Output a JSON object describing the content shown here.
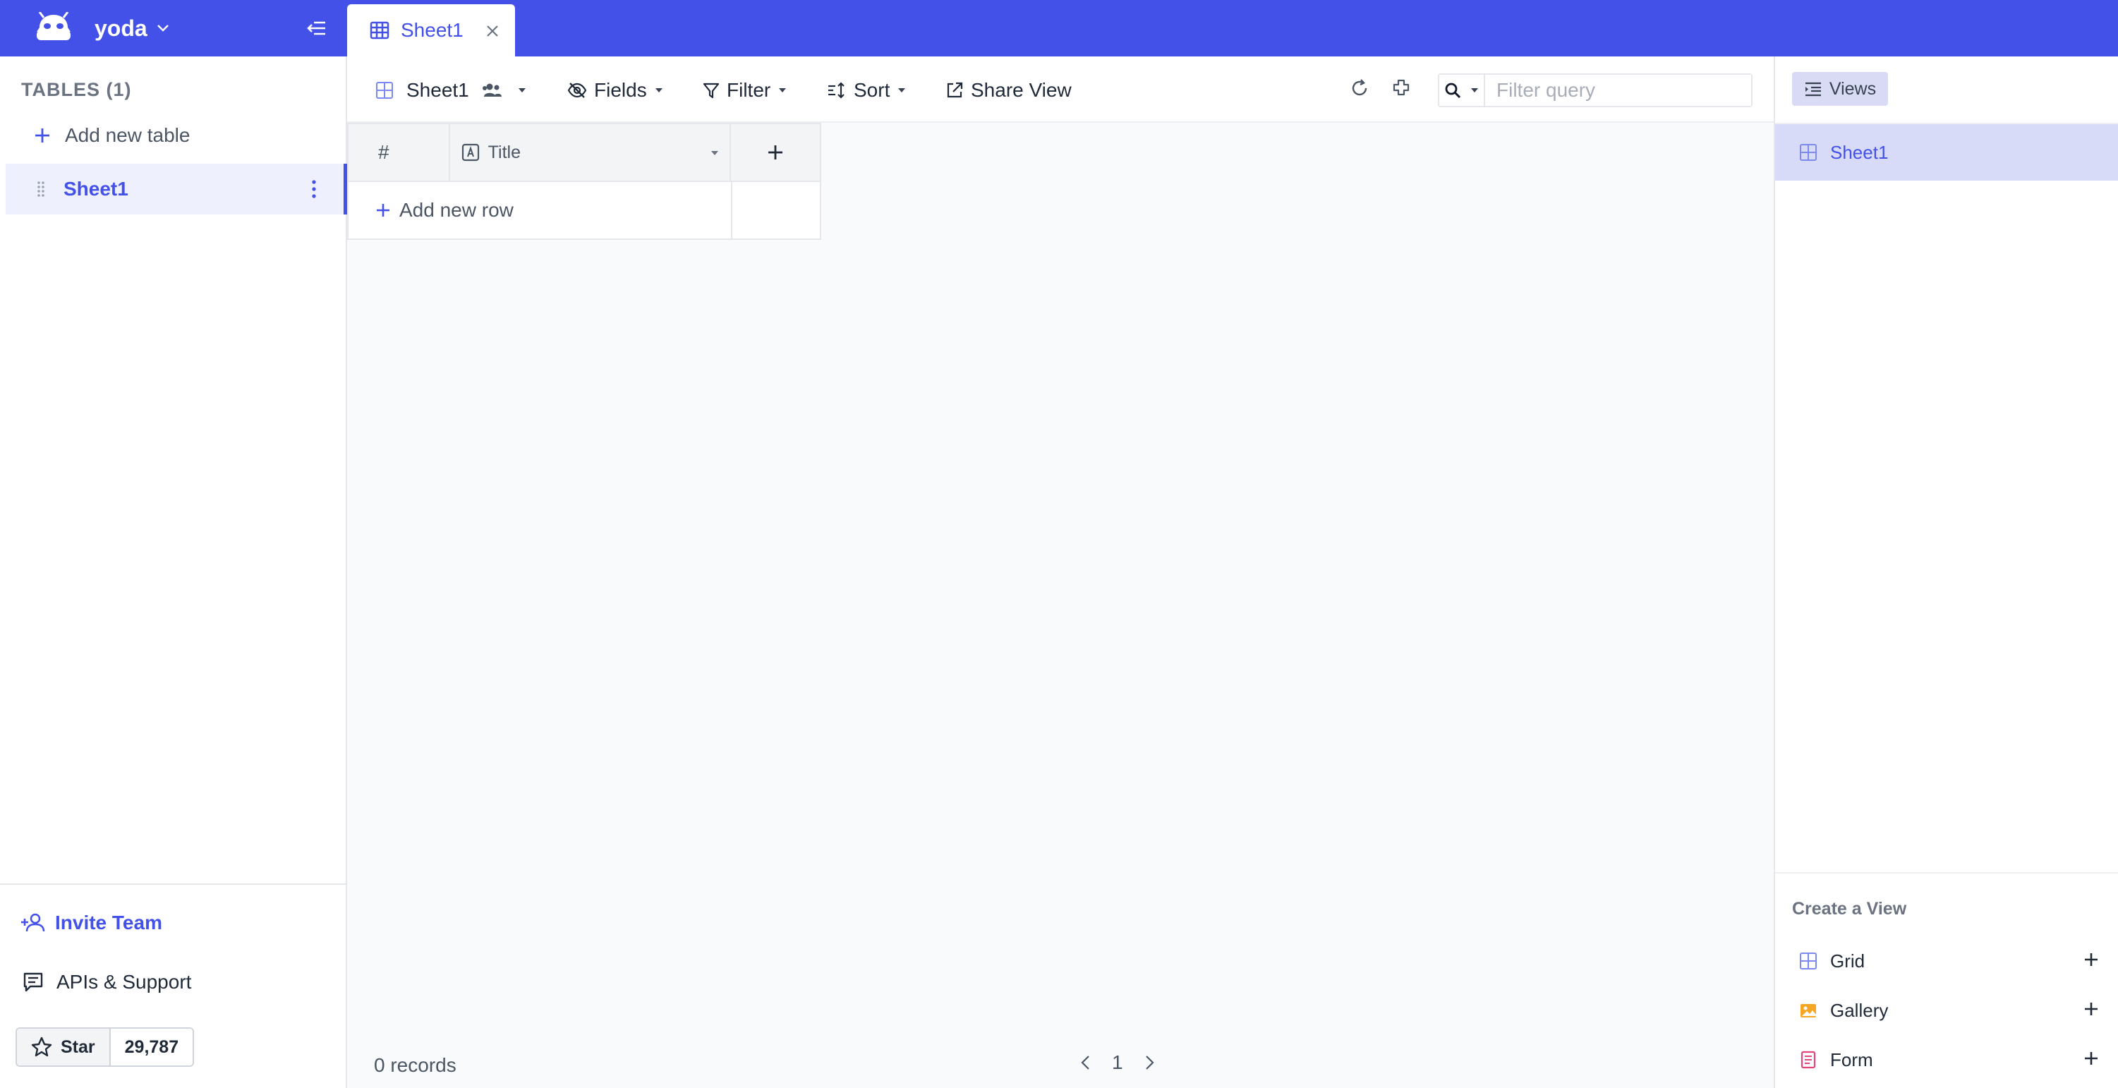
{
  "colors": {
    "brand": "#4351e8",
    "active_bg": "#eef0fd",
    "view_selected_bg": "#d8dbf8",
    "gallery_icon": "#f5a623",
    "form_icon": "#e0457b"
  },
  "workspace": {
    "name": "yoda"
  },
  "tab": {
    "label": "Sheet1"
  },
  "sidebar": {
    "heading": "TABLES (1)",
    "add_table_label": "Add new table",
    "tables": [
      {
        "label": "Sheet1"
      }
    ],
    "invite_label": "Invite Team",
    "apis_label": "APIs & Support",
    "github": {
      "star_label": "Star",
      "star_count": "29,787"
    }
  },
  "toolbar": {
    "view_name": "Sheet1",
    "fields_label": "Fields",
    "filter_label": "Filter",
    "sort_label": "Sort",
    "share_label": "Share View",
    "search_placeholder": "Filter query"
  },
  "grid": {
    "rownum_header": "#",
    "columns": [
      {
        "label": "Title",
        "type_icon": "text-type-icon"
      }
    ],
    "add_row_label": "Add new row"
  },
  "footer": {
    "records_label": "0 records",
    "page": "1"
  },
  "views_panel": {
    "toggle_label": "Views",
    "views": [
      {
        "label": "Sheet1",
        "icon": "grid-view-icon"
      }
    ],
    "create_heading": "Create a View",
    "create_options": [
      {
        "label": "Grid",
        "icon": "grid-view-icon"
      },
      {
        "label": "Gallery",
        "icon": "gallery-view-icon"
      },
      {
        "label": "Form",
        "icon": "form-view-icon"
      }
    ]
  }
}
